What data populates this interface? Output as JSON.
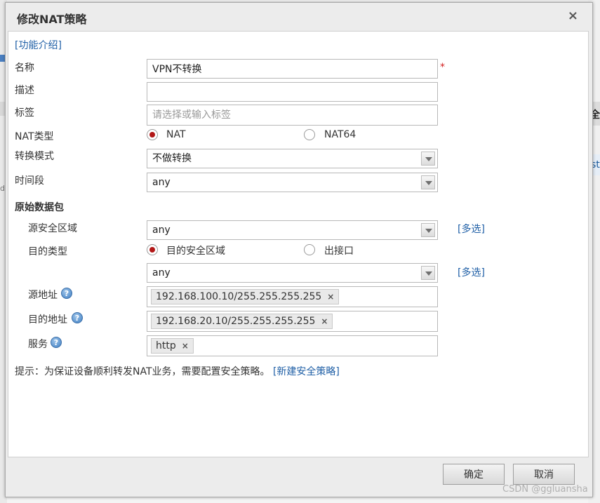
{
  "dialog": {
    "title": "修改NAT策略",
    "close_glyph": "×",
    "intro_link": "[功能介绍]"
  },
  "form": {
    "name": {
      "label": "名称",
      "value": "VPN不转换",
      "required_mark": "*"
    },
    "description": {
      "label": "描述",
      "value": ""
    },
    "tag": {
      "label": "标签",
      "placeholder": "请选择或输入标签"
    },
    "nat_type": {
      "label": "NAT类型",
      "options": [
        "NAT",
        "NAT64"
      ],
      "selected": "NAT"
    },
    "convert_mode": {
      "label": "转换模式",
      "value": "不做转换"
    },
    "time_range": {
      "label": "时间段",
      "value": "any"
    }
  },
  "original_packet": {
    "heading": "原始数据包",
    "src_zone": {
      "label": "源安全区域",
      "value": "any",
      "multi_link": "[多选]"
    },
    "dst_type": {
      "label": "目的类型",
      "options": [
        "目的安全区域",
        "出接口"
      ],
      "selected": "目的安全区域"
    },
    "dst_zone": {
      "value": "any",
      "multi_link": "[多选]"
    },
    "src_addr": {
      "label": "源地址",
      "tags": [
        "192.168.100.10/255.255.255.255"
      ]
    },
    "dst_addr": {
      "label": "目的地址",
      "tags": [
        "192.168.20.10/255.255.255.255"
      ]
    },
    "service": {
      "label": "服务",
      "tags": [
        "http"
      ]
    }
  },
  "tip": {
    "text": "提示：为保证设备顺利转发NAT业务，需要配置安全策略。",
    "link": "[新建安全策略]"
  },
  "buttons": {
    "ok": "确定",
    "cancel": "取消"
  },
  "background": {
    "right_header_fragment": "全",
    "right_row_fragment": "st",
    "left_fragment": "d"
  },
  "help_glyph": "?",
  "tag_remove_glyph": "×",
  "watermark": "CSDN @ggluansha",
  "colors": {
    "link": "#1f5fa6",
    "radio_selected": "#b21818",
    "required": "#d21f1f"
  }
}
